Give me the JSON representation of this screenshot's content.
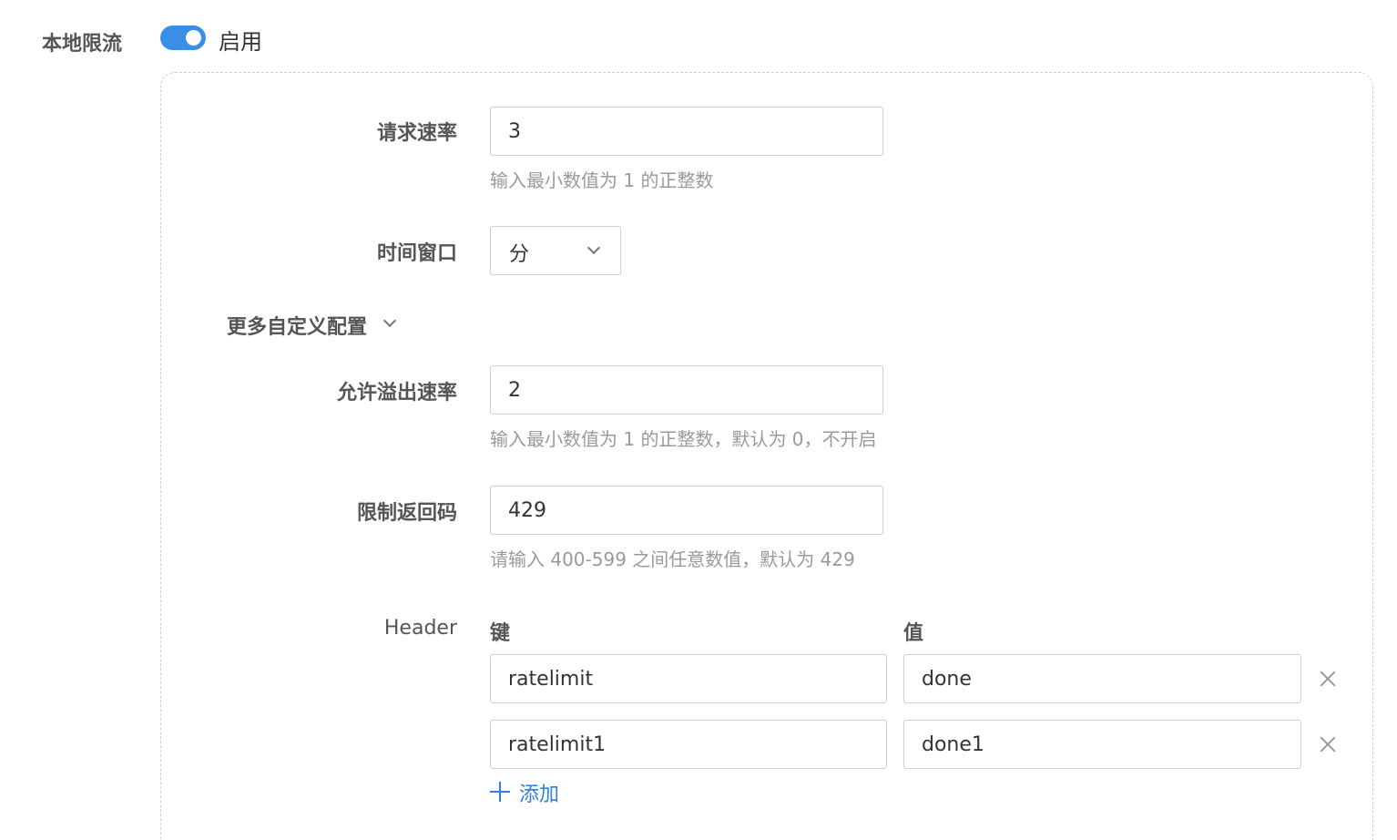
{
  "section": {
    "title": "本地限流",
    "toggle_label": "启用"
  },
  "form": {
    "rate": {
      "label": "请求速率",
      "value": "3",
      "hint": "输入最小数值为 1 的正整数"
    },
    "window": {
      "label": "时间窗口",
      "value": "分"
    },
    "more": {
      "label": "更多自定义配置"
    },
    "burst": {
      "label": "允许溢出速率",
      "value": "2",
      "hint": "输入最小数值为 1 的正整数，默认为 0，不开启"
    },
    "code": {
      "label": "限制返回码",
      "value": "429",
      "hint": "请输入 400-599 之间任意数值，默认为 429"
    },
    "header": {
      "label": "Header",
      "key_col": "键",
      "value_col": "值",
      "rows": [
        {
          "key": "ratelimit",
          "value": "done"
        },
        {
          "key": "ratelimit1",
          "value": "done1"
        }
      ],
      "add_label": "添加"
    }
  },
  "colors": {
    "accent": "#3a8ee6",
    "link": "#2f7fe0"
  }
}
